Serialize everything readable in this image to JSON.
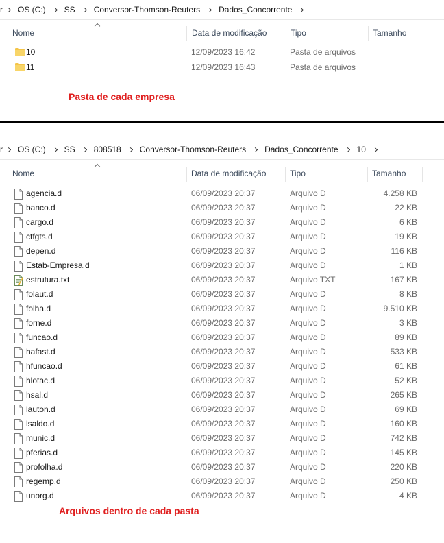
{
  "top": {
    "breadcrumb": [
      "r",
      "OS (C:)",
      "SS",
      "Conversor-Thomson-Reuters",
      "Dados_Concorrente"
    ],
    "columns": {
      "name": "Nome",
      "date": "Data de modificação",
      "type": "Tipo",
      "size": "Tamanho"
    },
    "items": [
      {
        "name": "10",
        "date": "12/09/2023 16:42",
        "type": "Pasta de arquivos",
        "size": "",
        "icon": "folder-icon"
      },
      {
        "name": "11",
        "date": "12/09/2023 16:43",
        "type": "Pasta de arquivos",
        "size": "",
        "icon": "folder-icon"
      }
    ],
    "annotation": "Pasta de cada empresa"
  },
  "bottom": {
    "breadcrumb": [
      "r",
      "OS (C:)",
      "SS",
      "808518",
      "Conversor-Thomson-Reuters",
      "Dados_Concorrente",
      "10"
    ],
    "columns": {
      "name": "Nome",
      "date": "Data de modificação",
      "type": "Tipo",
      "size": "Tamanho"
    },
    "items": [
      {
        "name": "agencia.d",
        "date": "06/09/2023 20:37",
        "type": "Arquivo D",
        "size": "4.258 KB",
        "icon": "file-icon"
      },
      {
        "name": "banco.d",
        "date": "06/09/2023 20:37",
        "type": "Arquivo D",
        "size": "22 KB",
        "icon": "file-icon"
      },
      {
        "name": "cargo.d",
        "date": "06/09/2023 20:37",
        "type": "Arquivo D",
        "size": "6 KB",
        "icon": "file-icon"
      },
      {
        "name": "ctfgts.d",
        "date": "06/09/2023 20:37",
        "type": "Arquivo D",
        "size": "19 KB",
        "icon": "file-icon"
      },
      {
        "name": "depen.d",
        "date": "06/09/2023 20:37",
        "type": "Arquivo D",
        "size": "116 KB",
        "icon": "file-icon"
      },
      {
        "name": "Estab-Empresa.d",
        "date": "06/09/2023 20:37",
        "type": "Arquivo D",
        "size": "1 KB",
        "icon": "file-icon"
      },
      {
        "name": "estrutura.txt",
        "date": "06/09/2023 20:37",
        "type": "Arquivo TXT",
        "size": "167 KB",
        "icon": "text-file-icon"
      },
      {
        "name": "folaut.d",
        "date": "06/09/2023 20:37",
        "type": "Arquivo D",
        "size": "8 KB",
        "icon": "file-icon"
      },
      {
        "name": "folha.d",
        "date": "06/09/2023 20:37",
        "type": "Arquivo D",
        "size": "9.510 KB",
        "icon": "file-icon"
      },
      {
        "name": "forne.d",
        "date": "06/09/2023 20:37",
        "type": "Arquivo D",
        "size": "3 KB",
        "icon": "file-icon"
      },
      {
        "name": "funcao.d",
        "date": "06/09/2023 20:37",
        "type": "Arquivo D",
        "size": "89 KB",
        "icon": "file-icon"
      },
      {
        "name": "hafast.d",
        "date": "06/09/2023 20:37",
        "type": "Arquivo D",
        "size": "533 KB",
        "icon": "file-icon"
      },
      {
        "name": "hfuncao.d",
        "date": "06/09/2023 20:37",
        "type": "Arquivo D",
        "size": "61 KB",
        "icon": "file-icon"
      },
      {
        "name": "hlotac.d",
        "date": "06/09/2023 20:37",
        "type": "Arquivo D",
        "size": "52 KB",
        "icon": "file-icon"
      },
      {
        "name": "hsal.d",
        "date": "06/09/2023 20:37",
        "type": "Arquivo D",
        "size": "265 KB",
        "icon": "file-icon"
      },
      {
        "name": "lauton.d",
        "date": "06/09/2023 20:37",
        "type": "Arquivo D",
        "size": "69 KB",
        "icon": "file-icon"
      },
      {
        "name": "lsaldo.d",
        "date": "06/09/2023 20:37",
        "type": "Arquivo D",
        "size": "160 KB",
        "icon": "file-icon"
      },
      {
        "name": "munic.d",
        "date": "06/09/2023 20:37",
        "type": "Arquivo D",
        "size": "742 KB",
        "icon": "file-icon"
      },
      {
        "name": "pferias.d",
        "date": "06/09/2023 20:37",
        "type": "Arquivo D",
        "size": "145 KB",
        "icon": "file-icon"
      },
      {
        "name": "profolha.d",
        "date": "06/09/2023 20:37",
        "type": "Arquivo D",
        "size": "220 KB",
        "icon": "file-icon"
      },
      {
        "name": "regemp.d",
        "date": "06/09/2023 20:37",
        "type": "Arquivo D",
        "size": "250 KB",
        "icon": "file-icon"
      },
      {
        "name": "unorg.d",
        "date": "06/09/2023 20:37",
        "type": "Arquivo D",
        "size": "4 KB",
        "icon": "file-icon"
      }
    ],
    "annotation": "Arquivos dentro de cada pasta"
  },
  "colors": {
    "annotation": "#e02020",
    "folder": "#f4c54a",
    "divider": "#000000"
  }
}
